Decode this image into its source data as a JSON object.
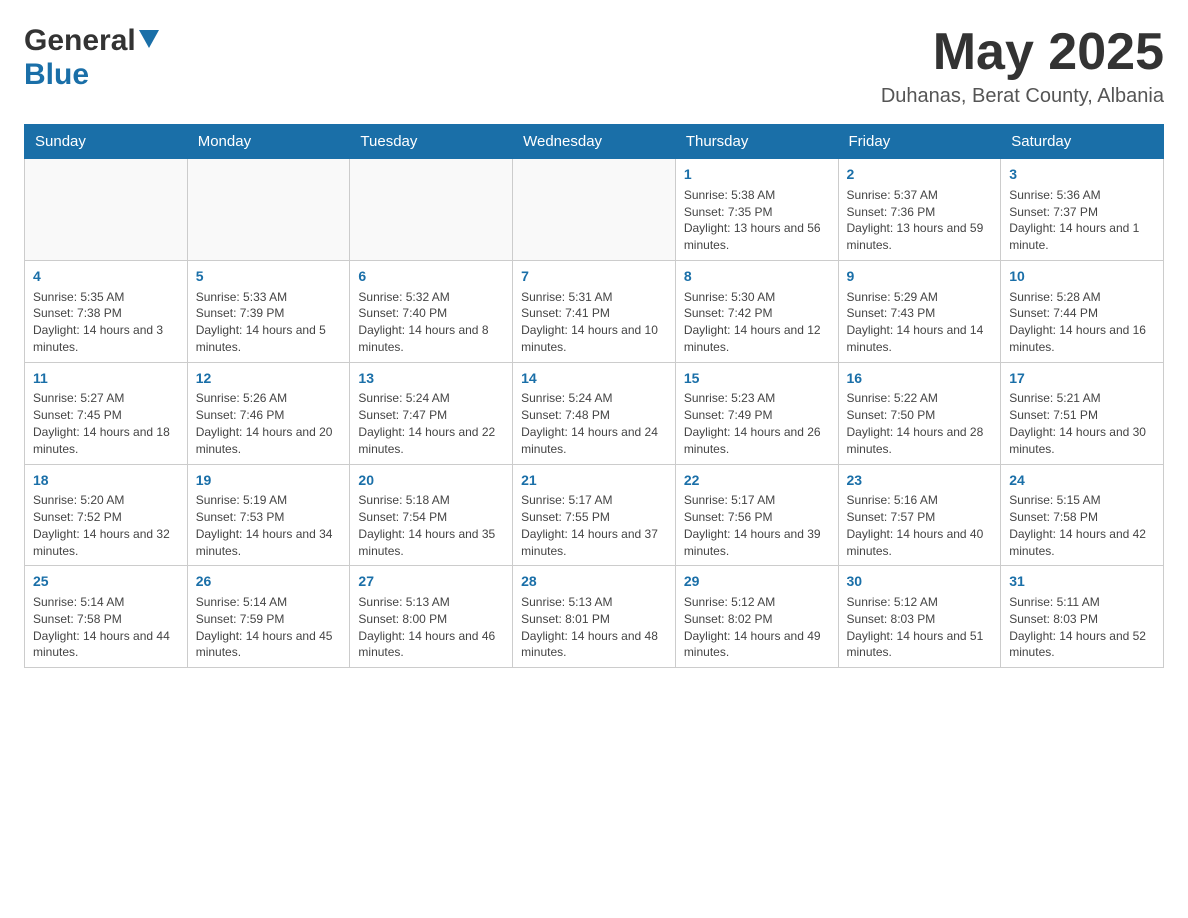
{
  "logo": {
    "general": "General",
    "blue": "Blue"
  },
  "title": {
    "month_year": "May 2025",
    "location": "Duhanas, Berat County, Albania"
  },
  "weekdays": [
    "Sunday",
    "Monday",
    "Tuesday",
    "Wednesday",
    "Thursday",
    "Friday",
    "Saturday"
  ],
  "weeks": [
    [
      {
        "day": "",
        "sunrise": "",
        "sunset": "",
        "daylight": ""
      },
      {
        "day": "",
        "sunrise": "",
        "sunset": "",
        "daylight": ""
      },
      {
        "day": "",
        "sunrise": "",
        "sunset": "",
        "daylight": ""
      },
      {
        "day": "",
        "sunrise": "",
        "sunset": "",
        "daylight": ""
      },
      {
        "day": "1",
        "sunrise": "Sunrise: 5:38 AM",
        "sunset": "Sunset: 7:35 PM",
        "daylight": "Daylight: 13 hours and 56 minutes."
      },
      {
        "day": "2",
        "sunrise": "Sunrise: 5:37 AM",
        "sunset": "Sunset: 7:36 PM",
        "daylight": "Daylight: 13 hours and 59 minutes."
      },
      {
        "day": "3",
        "sunrise": "Sunrise: 5:36 AM",
        "sunset": "Sunset: 7:37 PM",
        "daylight": "Daylight: 14 hours and 1 minute."
      }
    ],
    [
      {
        "day": "4",
        "sunrise": "Sunrise: 5:35 AM",
        "sunset": "Sunset: 7:38 PM",
        "daylight": "Daylight: 14 hours and 3 minutes."
      },
      {
        "day": "5",
        "sunrise": "Sunrise: 5:33 AM",
        "sunset": "Sunset: 7:39 PM",
        "daylight": "Daylight: 14 hours and 5 minutes."
      },
      {
        "day": "6",
        "sunrise": "Sunrise: 5:32 AM",
        "sunset": "Sunset: 7:40 PM",
        "daylight": "Daylight: 14 hours and 8 minutes."
      },
      {
        "day": "7",
        "sunrise": "Sunrise: 5:31 AM",
        "sunset": "Sunset: 7:41 PM",
        "daylight": "Daylight: 14 hours and 10 minutes."
      },
      {
        "day": "8",
        "sunrise": "Sunrise: 5:30 AM",
        "sunset": "Sunset: 7:42 PM",
        "daylight": "Daylight: 14 hours and 12 minutes."
      },
      {
        "day": "9",
        "sunrise": "Sunrise: 5:29 AM",
        "sunset": "Sunset: 7:43 PM",
        "daylight": "Daylight: 14 hours and 14 minutes."
      },
      {
        "day": "10",
        "sunrise": "Sunrise: 5:28 AM",
        "sunset": "Sunset: 7:44 PM",
        "daylight": "Daylight: 14 hours and 16 minutes."
      }
    ],
    [
      {
        "day": "11",
        "sunrise": "Sunrise: 5:27 AM",
        "sunset": "Sunset: 7:45 PM",
        "daylight": "Daylight: 14 hours and 18 minutes."
      },
      {
        "day": "12",
        "sunrise": "Sunrise: 5:26 AM",
        "sunset": "Sunset: 7:46 PM",
        "daylight": "Daylight: 14 hours and 20 minutes."
      },
      {
        "day": "13",
        "sunrise": "Sunrise: 5:24 AM",
        "sunset": "Sunset: 7:47 PM",
        "daylight": "Daylight: 14 hours and 22 minutes."
      },
      {
        "day": "14",
        "sunrise": "Sunrise: 5:24 AM",
        "sunset": "Sunset: 7:48 PM",
        "daylight": "Daylight: 14 hours and 24 minutes."
      },
      {
        "day": "15",
        "sunrise": "Sunrise: 5:23 AM",
        "sunset": "Sunset: 7:49 PM",
        "daylight": "Daylight: 14 hours and 26 minutes."
      },
      {
        "day": "16",
        "sunrise": "Sunrise: 5:22 AM",
        "sunset": "Sunset: 7:50 PM",
        "daylight": "Daylight: 14 hours and 28 minutes."
      },
      {
        "day": "17",
        "sunrise": "Sunrise: 5:21 AM",
        "sunset": "Sunset: 7:51 PM",
        "daylight": "Daylight: 14 hours and 30 minutes."
      }
    ],
    [
      {
        "day": "18",
        "sunrise": "Sunrise: 5:20 AM",
        "sunset": "Sunset: 7:52 PM",
        "daylight": "Daylight: 14 hours and 32 minutes."
      },
      {
        "day": "19",
        "sunrise": "Sunrise: 5:19 AM",
        "sunset": "Sunset: 7:53 PM",
        "daylight": "Daylight: 14 hours and 34 minutes."
      },
      {
        "day": "20",
        "sunrise": "Sunrise: 5:18 AM",
        "sunset": "Sunset: 7:54 PM",
        "daylight": "Daylight: 14 hours and 35 minutes."
      },
      {
        "day": "21",
        "sunrise": "Sunrise: 5:17 AM",
        "sunset": "Sunset: 7:55 PM",
        "daylight": "Daylight: 14 hours and 37 minutes."
      },
      {
        "day": "22",
        "sunrise": "Sunrise: 5:17 AM",
        "sunset": "Sunset: 7:56 PM",
        "daylight": "Daylight: 14 hours and 39 minutes."
      },
      {
        "day": "23",
        "sunrise": "Sunrise: 5:16 AM",
        "sunset": "Sunset: 7:57 PM",
        "daylight": "Daylight: 14 hours and 40 minutes."
      },
      {
        "day": "24",
        "sunrise": "Sunrise: 5:15 AM",
        "sunset": "Sunset: 7:58 PM",
        "daylight": "Daylight: 14 hours and 42 minutes."
      }
    ],
    [
      {
        "day": "25",
        "sunrise": "Sunrise: 5:14 AM",
        "sunset": "Sunset: 7:58 PM",
        "daylight": "Daylight: 14 hours and 44 minutes."
      },
      {
        "day": "26",
        "sunrise": "Sunrise: 5:14 AM",
        "sunset": "Sunset: 7:59 PM",
        "daylight": "Daylight: 14 hours and 45 minutes."
      },
      {
        "day": "27",
        "sunrise": "Sunrise: 5:13 AM",
        "sunset": "Sunset: 8:00 PM",
        "daylight": "Daylight: 14 hours and 46 minutes."
      },
      {
        "day": "28",
        "sunrise": "Sunrise: 5:13 AM",
        "sunset": "Sunset: 8:01 PM",
        "daylight": "Daylight: 14 hours and 48 minutes."
      },
      {
        "day": "29",
        "sunrise": "Sunrise: 5:12 AM",
        "sunset": "Sunset: 8:02 PM",
        "daylight": "Daylight: 14 hours and 49 minutes."
      },
      {
        "day": "30",
        "sunrise": "Sunrise: 5:12 AM",
        "sunset": "Sunset: 8:03 PM",
        "daylight": "Daylight: 14 hours and 51 minutes."
      },
      {
        "day": "31",
        "sunrise": "Sunrise: 5:11 AM",
        "sunset": "Sunset: 8:03 PM",
        "daylight": "Daylight: 14 hours and 52 minutes."
      }
    ]
  ]
}
